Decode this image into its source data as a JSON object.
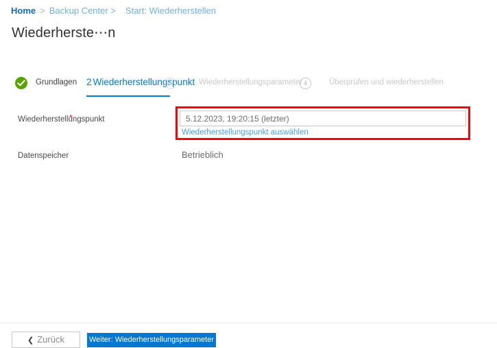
{
  "breadcrumb": {
    "home": "Home",
    "separator": ">",
    "backup_center": "Backup Center >",
    "current": "Start: Wiederherstellen"
  },
  "page": {
    "title": "Wiederherste⋯n"
  },
  "steps": [
    {
      "label": "Grundlagen",
      "state": "done",
      "icon": "check-circle-icon"
    },
    {
      "number": "2",
      "label": "Wiederherstellungspunkt",
      "state": "active",
      "ghost_badge": "3"
    },
    {
      "label": "Wiederherstellungsparameter",
      "state": "upcoming",
      "badge": "4"
    },
    {
      "label": "Überprüfen und wiederherstellen",
      "state": "upcoming",
      "badge": ""
    }
  ],
  "form": {
    "recovery_point": {
      "label": "Wiederherstellungspunkt",
      "required_marker": "*",
      "value": "5.12.2023, 19:20:15 (letzter)",
      "placeholder": "5.12.2023, 19:20:15 (letzter)",
      "link": "Wiederherstellungspunkt auswählen"
    },
    "datastore": {
      "label": "Datenspeicher",
      "value": "Betrieblich"
    }
  },
  "footer": {
    "back_chevron": "❮",
    "back_label": "Zurück",
    "next_label": "Weiter: Wiederherstellungsparameter"
  },
  "colors": {
    "accent": "#0078d4",
    "link": "#71afe5",
    "success": "#57a300",
    "highlight": "#ff0000",
    "required": "#e81123"
  }
}
